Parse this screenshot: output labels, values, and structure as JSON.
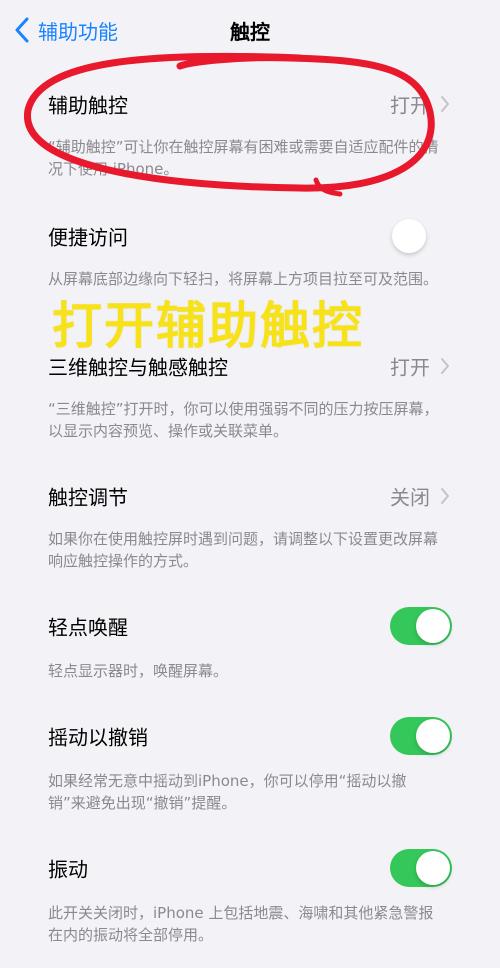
{
  "nav": {
    "back_label": "辅助功能",
    "title": "触控"
  },
  "rows": [
    {
      "label": "辅助触控",
      "value": "打开",
      "footer": "“辅助触控”可让你在触控屏幕有困难或需要自适应配件的情况下使用 iPhone。"
    },
    {
      "label": "便捷访问",
      "switch": "off",
      "footer": "从屏幕底部边缘向下轻扫，将屏幕上方项目拉至可及范围。"
    },
    {
      "label": "三维触控与触感触控",
      "value": "打开",
      "footer": "“三维触控”打开时，你可以使用强弱不同的压力按压屏幕，以显示内容预览、操作或关联菜单。"
    },
    {
      "label": "触控调节",
      "value": "关闭",
      "footer": "如果你在使用触控屏时遇到问题，请调整以下设置更改屏幕响应触控操作的方式。"
    },
    {
      "label": "轻点唤醒",
      "switch": "on",
      "footer": "轻点显示器时，唤醒屏幕。"
    },
    {
      "label": "摇动以撤销",
      "switch": "on",
      "footer": "如果经常无意中摇动到iPhone，你可以停用“摇动以撤销”来避免出现“撤销”提醒。"
    },
    {
      "label": "振动",
      "switch": "on",
      "footer": "此开关关闭时，iPhone 上包括地震、海啸和其他紧急警报在内的振动将全部停用。"
    }
  ],
  "overlay": {
    "caption": "打开辅助触控",
    "caption_color": "#f7e21a",
    "circle_color": "#e8192c"
  },
  "colors": {
    "accent": "#1a84ff",
    "switch_on": "#34c759",
    "secondary_text": "#8a8a8e"
  }
}
